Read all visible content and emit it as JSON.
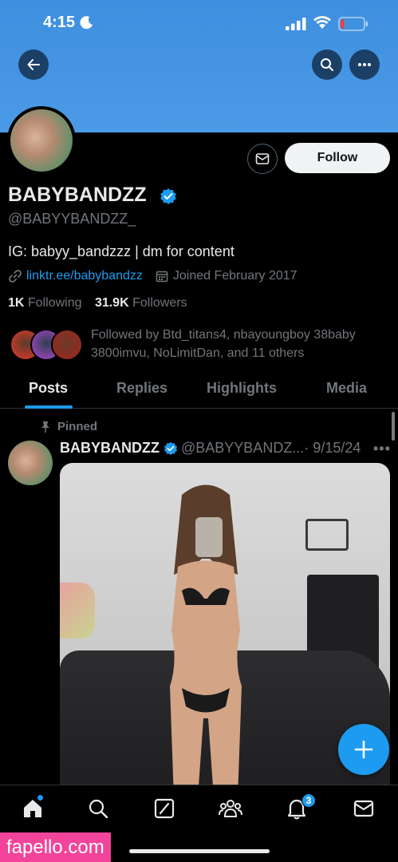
{
  "status_bar": {
    "time": "4:15"
  },
  "profile": {
    "name": "BABYBANDZZ",
    "handle": "@BABYYBANDZZ_",
    "bio": "IG: babyy_bandzzz | dm for content",
    "link": "linktr.ee/babybandzz",
    "joined": "Joined February 2017",
    "following_count": "1K",
    "following_label": " Following",
    "followers_count": "31.9K",
    "followers_label": " Followers",
    "followed_by": "Followed by Btd_titans4, nbayoungboy 38baby 3800imvu, NoLimitDan, and 11 others",
    "follow_label": "Follow"
  },
  "tabs": [
    {
      "label": "Posts",
      "active": true
    },
    {
      "label": "Replies"
    },
    {
      "label": "Highlights"
    },
    {
      "label": "Media"
    }
  ],
  "post": {
    "pinned_label": "Pinned",
    "author": "BABYBANDZZ",
    "handle": "@BABYYBANDZ...",
    "date": "· 9/15/24"
  },
  "nav": {
    "notifications_badge": "3"
  },
  "watermark": "fapello.com",
  "colors": {
    "accent": "#1d9bf0",
    "banner": "#4a9ae6",
    "watermark": "#f2449a"
  }
}
